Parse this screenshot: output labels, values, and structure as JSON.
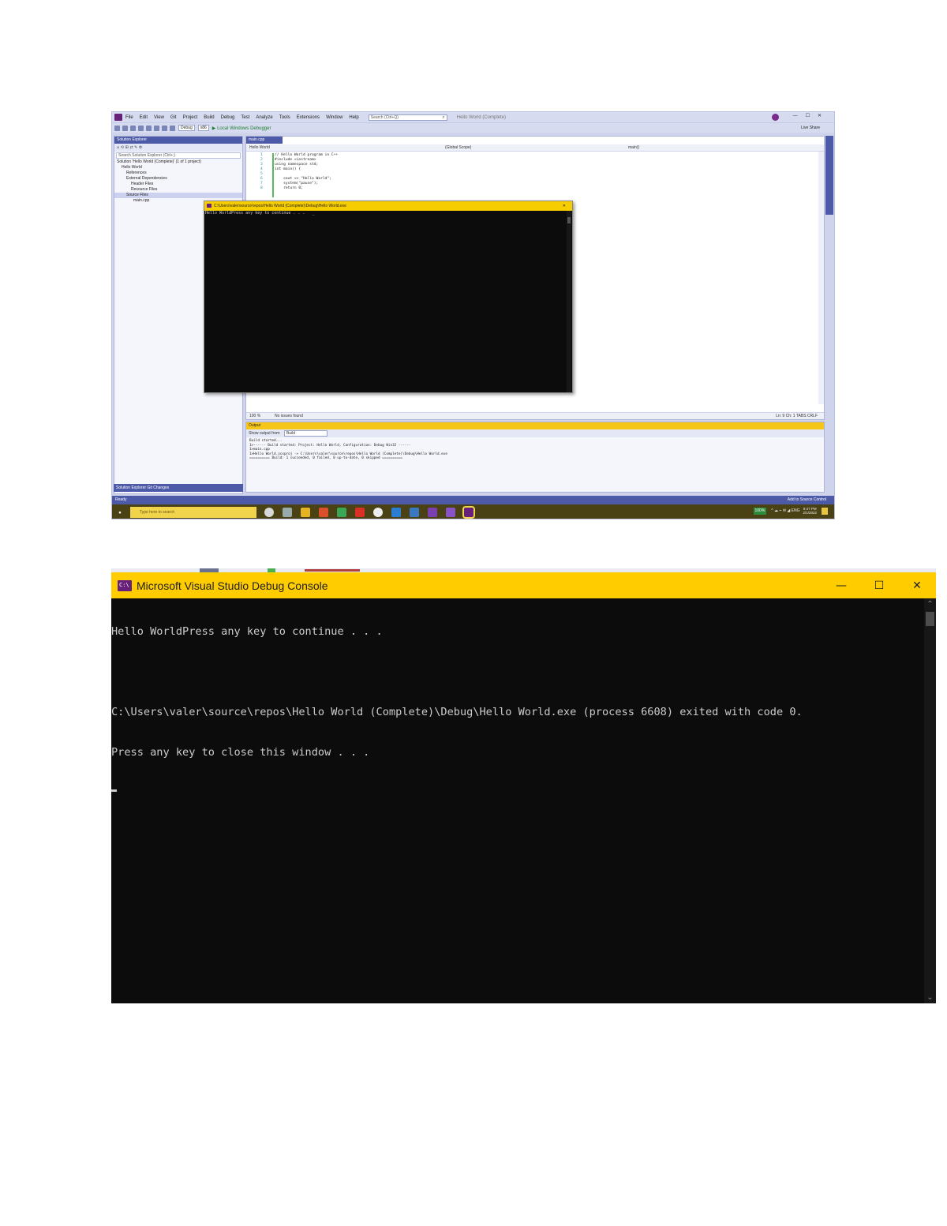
{
  "ide": {
    "menu": [
      "File",
      "Edit",
      "View",
      "Git",
      "Project",
      "Build",
      "Debug",
      "Test",
      "Analyze",
      "Tools",
      "Extensions",
      "Window",
      "Help"
    ],
    "search_placeholder": "Search (Ctrl+Q)",
    "solution_name": "Hello World (Complete)",
    "toolbar": {
      "config": "Debug",
      "platform": "x86",
      "run_label": "Local Windows Debugger"
    },
    "live_share": "Live Share",
    "solution_explorer": {
      "title": "Solution Explorer",
      "search_placeholder": "Search Solution Explorer (Ctrl+;)",
      "items": [
        "Solution 'Hello World (Complete)' (1 of 1 project)",
        "Hello World",
        "References",
        "External Dependencies",
        "Header Files",
        "Resource Files",
        "Source Files",
        "main.cpp"
      ],
      "bottom_tabs": "Solution Explorer   Git Changes"
    },
    "editor": {
      "tab": "main.cpp",
      "nav_left": "Hello World",
      "nav_mid": "(Global Scope)",
      "nav_right": "main()",
      "lines": [
        {
          "n": "1",
          "text": "// Hello World program in C++"
        },
        {
          "n": "2",
          "text": "#include <iostream>"
        },
        {
          "n": "3",
          "text": "using namespace std;"
        },
        {
          "n": "4",
          "text": "int main() {"
        },
        {
          "n": "5",
          "text": ""
        },
        {
          "n": "6",
          "text": "    cout << \"Hello World\";"
        },
        {
          "n": "7",
          "text": "    system(\"pause\");"
        },
        {
          "n": "8",
          "text": "    return 0;"
        }
      ],
      "zoom": "100 %",
      "issues": "No issues found",
      "position": "Ln: 9   Ch: 1   TABS   CRLF"
    },
    "output": {
      "title": "Output",
      "show_from_label": "Show output from:",
      "show_from_value": "Build",
      "text": "Build started...\n1>------ Build started: Project: Hello World, Configuration: Debug Win32 ------\n1>main.cpp\n1>Hello World.vcxproj -> C:\\Users\\valer\\source\\repos\\Hello World (Complete)\\Debug\\Hello World.exe\n========== Build: 1 succeeded, 0 failed, 0 up-to-date, 0 skipped =========="
    },
    "status_bar": {
      "left": "Ready",
      "right": "Add to Source Control"
    },
    "taskbar": {
      "search": "Type here to search",
      "battery": "100%",
      "time": "9:47 PM",
      "date": "2/1/2022"
    },
    "mini_console": {
      "title": "C:\\Users\\valer\\source\\repos\\Hello World (Complete)\\Debug\\Hello World.exe",
      "line": "Hello WorldPress any key to continue . . ."
    }
  },
  "debug_console": {
    "title": "Microsoft Visual Studio Debug Console",
    "minimize": "—",
    "maximize": "☐",
    "close": "✕",
    "lines": [
      "Hello WorldPress any key to continue . . .",
      "",
      "C:\\Users\\valer\\source\\repos\\Hello World (Complete)\\Debug\\Hello World.exe (process 6608) exited with code 0.",
      "Press any key to close this window . . ."
    ],
    "colors": {
      "titlebar": "#ffcc00",
      "background": "#0c0c0c",
      "text": "#cccccc",
      "vs_purple": "#68217a"
    }
  }
}
